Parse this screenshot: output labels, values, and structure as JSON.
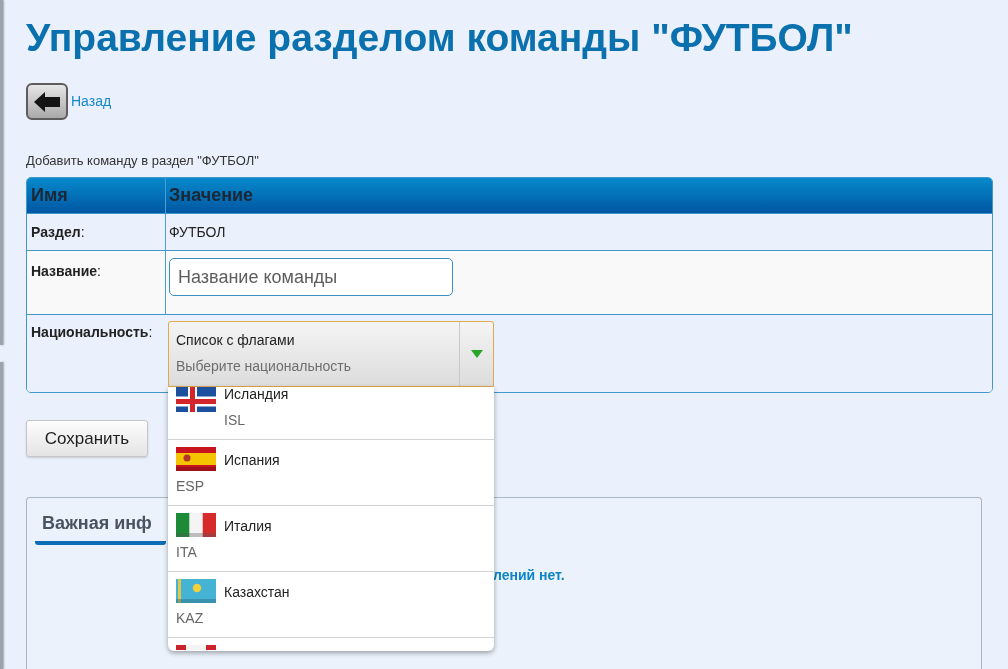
{
  "title": "Управление разделом команды \"ФУТБОЛ\"",
  "back": {
    "label": "Назад"
  },
  "form_caption": "Добавить команду в раздел \"ФУТБОЛ\"",
  "form_table": {
    "columns": [
      "Имя",
      "Значение"
    ],
    "rows": [
      {
        "kind": "text",
        "label": "**Раздел**:",
        "value": "ФУТБОЛ"
      },
      {
        "kind": "input",
        "label": "**Название**:",
        "placeholder": "Название команды"
      },
      {
        "kind": "select",
        "label": "**Национальность**:",
        "select": {
          "label": "Список с флагами",
          "placeholder": "Выберите национальность",
          "expanded": true,
          "options": [
            {
              "name": "Исландия",
              "code": "ISL",
              "selected": false
            },
            {
              "name": "Испания",
              "code": "ESP",
              "selected": false
            },
            {
              "name": "Италия",
              "code": "ITA",
              "selected": false
            },
            {
              "name": "Казахстан",
              "code": "KAZ",
              "selected": false
            }
          ],
          "more_below": true
        }
      }
    ]
  },
  "save_button": {
    "label": "Сохранить"
  },
  "info_panel": {
    "title": "Важная инф",
    "message": "лений нет."
  }
}
